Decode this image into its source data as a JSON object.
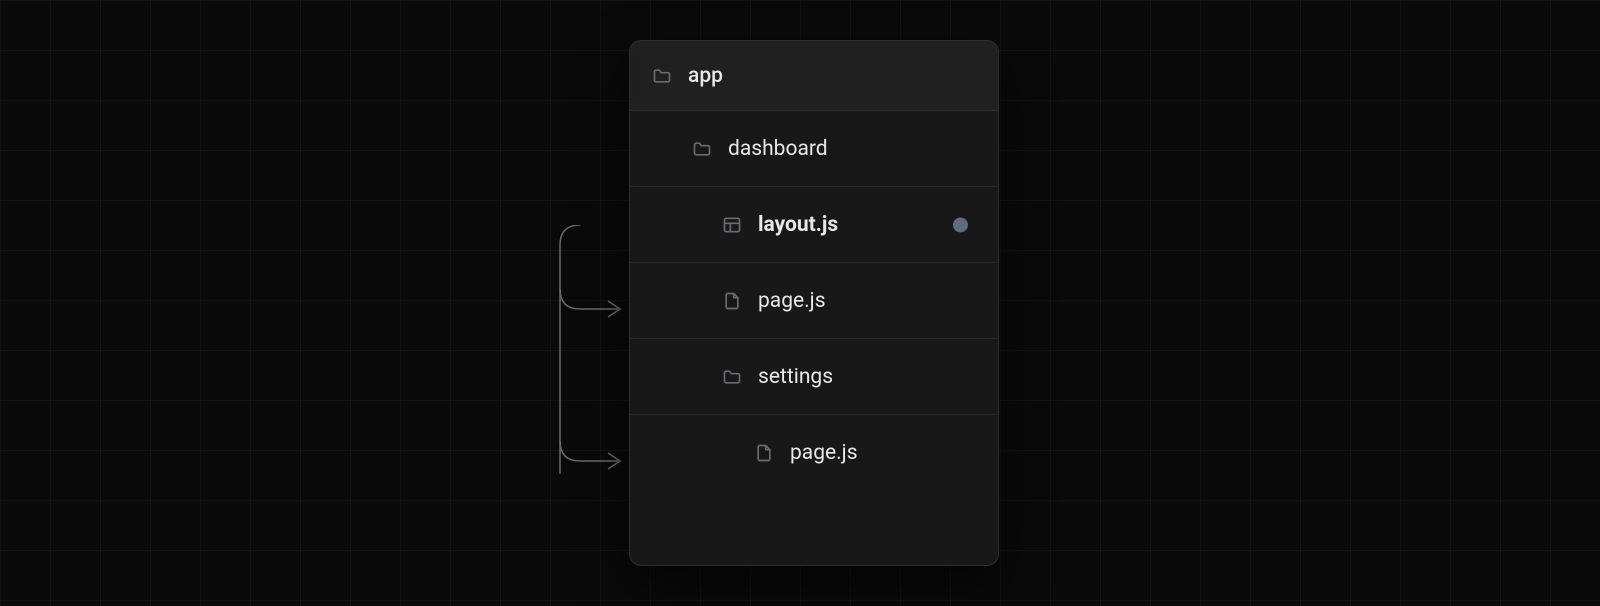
{
  "tree": {
    "root": {
      "label": "app",
      "icon": "folder"
    },
    "items": [
      {
        "label": "dashboard",
        "icon": "folder",
        "indent": 1
      },
      {
        "label": "layout.js",
        "icon": "layout",
        "indent": 2,
        "bold": true,
        "marked": true
      },
      {
        "label": "page.js",
        "icon": "file",
        "indent": 2
      },
      {
        "label": "settings",
        "icon": "folder",
        "indent": 2
      },
      {
        "label": "page.js",
        "icon": "file",
        "indent": 3
      }
    ]
  }
}
